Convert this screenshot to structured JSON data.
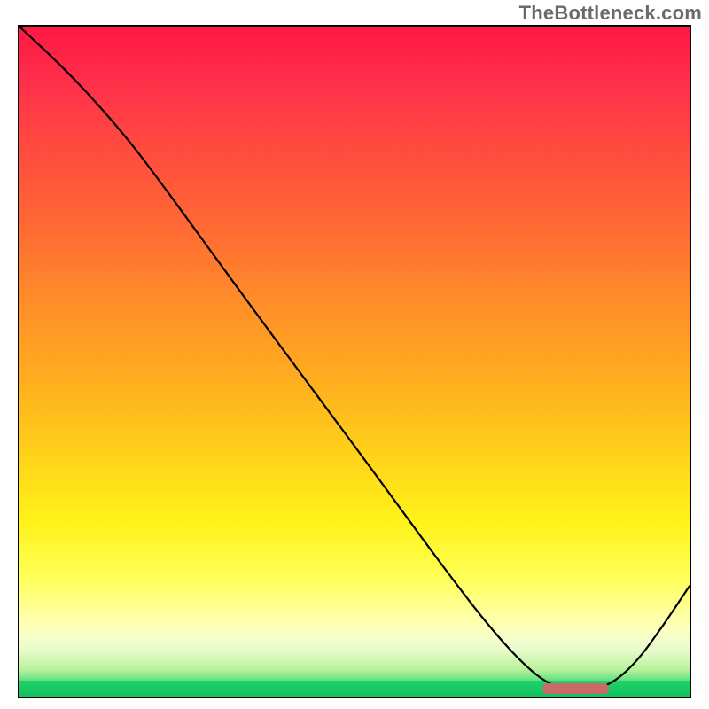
{
  "watermark": "TheBottleneck.com",
  "chart_data": {
    "type": "line",
    "title": "",
    "xlabel": "",
    "ylabel": "",
    "xlim": [
      0,
      100
    ],
    "ylim": [
      0,
      100
    ],
    "grid": false,
    "curve": [
      {
        "x": 0,
        "y": 100.0
      },
      {
        "x": 8,
        "y": 92.5
      },
      {
        "x": 16,
        "y": 83.5
      },
      {
        "x": 22,
        "y": 75.5
      },
      {
        "x": 26,
        "y": 70.0
      },
      {
        "x": 34,
        "y": 59.0
      },
      {
        "x": 44,
        "y": 45.5
      },
      {
        "x": 54,
        "y": 32.0
      },
      {
        "x": 62,
        "y": 21.0
      },
      {
        "x": 70,
        "y": 10.5
      },
      {
        "x": 76,
        "y": 4.0
      },
      {
        "x": 80,
        "y": 1.3
      },
      {
        "x": 84,
        "y": 0.8
      },
      {
        "x": 88,
        "y": 1.6
      },
      {
        "x": 92,
        "y": 5.0
      },
      {
        "x": 96,
        "y": 10.5
      },
      {
        "x": 100,
        "y": 16.5
      }
    ],
    "optimal_marker": {
      "x_start": 78,
      "x_end": 88,
      "y": 1.2
    },
    "gradient_stops": [
      {
        "pos": 0.0,
        "color": "#ff1744"
      },
      {
        "pos": 0.3,
        "color": "#ff6a34"
      },
      {
        "pos": 0.64,
        "color": "#ffd21a"
      },
      {
        "pos": 0.82,
        "color": "#ffff55"
      },
      {
        "pos": 0.93,
        "color": "#e9fccc"
      },
      {
        "pos": 0.976,
        "color": "#5fe081"
      },
      {
        "pos": 1.0,
        "color": "#14c05e"
      }
    ]
  }
}
